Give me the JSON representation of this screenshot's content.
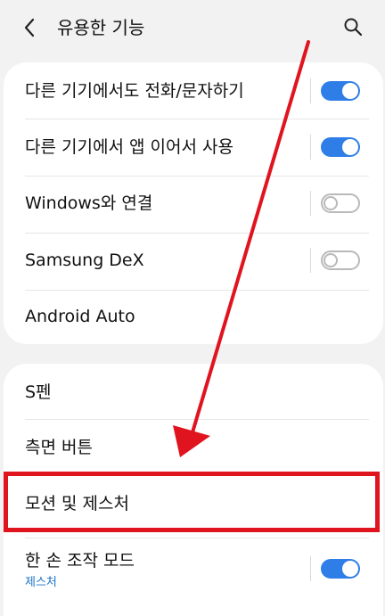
{
  "header": {
    "title": "유용한 기능",
    "back_icon": "chevron-left-icon",
    "search_icon": "search-icon"
  },
  "group1": [
    {
      "label": "다른 기기에서도 전화/문자하기",
      "toggle": "on"
    },
    {
      "label": "다른 기기에서 앱 이어서 사용",
      "toggle": "on"
    },
    {
      "label": "Windows와 연결",
      "toggle": "off"
    },
    {
      "label": "Samsung DeX",
      "toggle": "off"
    },
    {
      "label": "Android Auto"
    }
  ],
  "group2": [
    {
      "label": "S펜"
    },
    {
      "label": "측면 버튼"
    },
    {
      "label": "모션 및 제스처",
      "highlighted": true
    },
    {
      "label": "한 손 조작 모드",
      "sublabel": "제스처",
      "toggle": "on"
    }
  ],
  "colors": {
    "toggle_on": "#2f7ee8",
    "highlight": "#e0141f",
    "sublabel": "#1a73c9"
  }
}
